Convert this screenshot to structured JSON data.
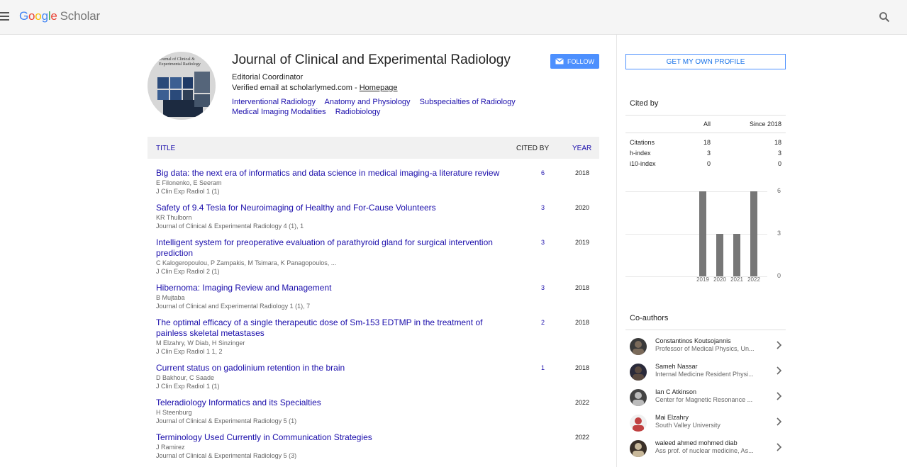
{
  "header": {
    "logo_letters": [
      "G",
      "o",
      "o",
      "g",
      "l",
      "e"
    ],
    "logo_product": "Scholar"
  },
  "profile": {
    "name": "Journal of Clinical and Experimental Radiology",
    "affiliation": "Editorial Coordinator",
    "email_text": "Verified email at scholarlymed.com - ",
    "homepage_label": "Homepage",
    "avatar_text": "Journal of Clinical & Experimental Radiology",
    "interests": [
      "Interventional Radiology",
      "Anatomy and Physiology",
      "Subspecialties of Radiology",
      "Medical Imaging Modalities",
      "Radiobiology"
    ],
    "follow_label": "FOLLOW"
  },
  "table": {
    "col_title": "TITLE",
    "col_cited": "CITED BY",
    "col_year": "YEAR",
    "rows": [
      {
        "title": "Big data: the next era of informatics and data science in medical imaging-a literature review",
        "authors": "E Filonenko, E Seeram",
        "venue": "J Clin Exp Radiol 1 (1)",
        "cited": "6",
        "year": "2018"
      },
      {
        "title": "Safety of 9.4 Tesla for Neuroimaging of Healthy and For-Cause Volunteers",
        "authors": "KR Thulborn",
        "venue": "Journal of Clinical & Experimental Radiology 4 (1), 1",
        "cited": "3",
        "year": "2020"
      },
      {
        "title": "Intelligent system for preoperative evaluation of parathyroid gland for surgical intervention prediction",
        "authors": "C Kalogeropoulou, P Zampakis, M Tsimara, K Panagopoulos, ...",
        "venue": "J Clin Exp Radiol 2 (1)",
        "cited": "3",
        "year": "2019"
      },
      {
        "title": "Hibernoma: Imaging Review and Management",
        "authors": "B Mujtaba",
        "venue": "Journal of Clinical and Experimental Radiology 1 (1), 7",
        "cited": "3",
        "year": "2018"
      },
      {
        "title": "The optimal efficacy of a single therapeutic dose of Sm-153 EDTMP in the treatment of painless skeletal metastases",
        "authors": "M Elzahry, W Diab, H Sinzinger",
        "venue": "J Clin Exp Radiol 1 1, 2",
        "cited": "2",
        "year": "2018"
      },
      {
        "title": "Current status on gadolinium retention in the brain",
        "authors": "D Bakhour, C Saade",
        "venue": "J Clin Exp Radiol 1 (1)",
        "cited": "1",
        "year": "2018"
      },
      {
        "title": "Teleradiology Informatics and its Specialties",
        "authors": "H Steenburg",
        "venue": "Journal of Clinical & Experimental Radiology 5 (1)",
        "cited": "",
        "year": "2022"
      },
      {
        "title": "Terminology Used Currently in Communication Strategies",
        "authors": "J Ramirez",
        "venue": "Journal of Clinical & Experimental Radiology 5 (3)",
        "cited": "",
        "year": "2022"
      }
    ]
  },
  "sidebar": {
    "own_profile_label": "GET MY OWN PROFILE",
    "cited_by_title": "Cited by",
    "col_all": "All",
    "col_since": "Since 2018",
    "metrics": [
      {
        "label": "Citations",
        "all": "18",
        "since": "18"
      },
      {
        "label": "h-index",
        "all": "3",
        "since": "3"
      },
      {
        "label": "i10-index",
        "all": "0",
        "since": "0"
      }
    ],
    "coauthors_title": "Co-authors",
    "coauthors": [
      {
        "name": "Constantinos Koutsojannis",
        "affiliation": "Professor of Medical Physics, Un..."
      },
      {
        "name": "Sameh Nassar",
        "affiliation": "Internal Medicine Resident Physi..."
      },
      {
        "name": "Ian C Atkinson",
        "affiliation": "Center for Magnetic Resonance ..."
      },
      {
        "name": "Mai Elzahry",
        "affiliation": "South Valley University"
      },
      {
        "name": "waleed ahmed mohmed diab",
        "affiliation": "Ass prof. of nuclear medicine, As..."
      }
    ]
  },
  "chart_data": {
    "type": "bar",
    "categories": [
      "2019",
      "2020",
      "2021",
      "2022"
    ],
    "values": [
      6,
      3,
      3,
      6
    ],
    "ylim": [
      0,
      6
    ],
    "yticks": [
      "0",
      "3",
      "6"
    ],
    "grid": true
  },
  "colors": {
    "link": "#1a0dab",
    "accent": "#4d90fe",
    "bar": "#777777"
  }
}
